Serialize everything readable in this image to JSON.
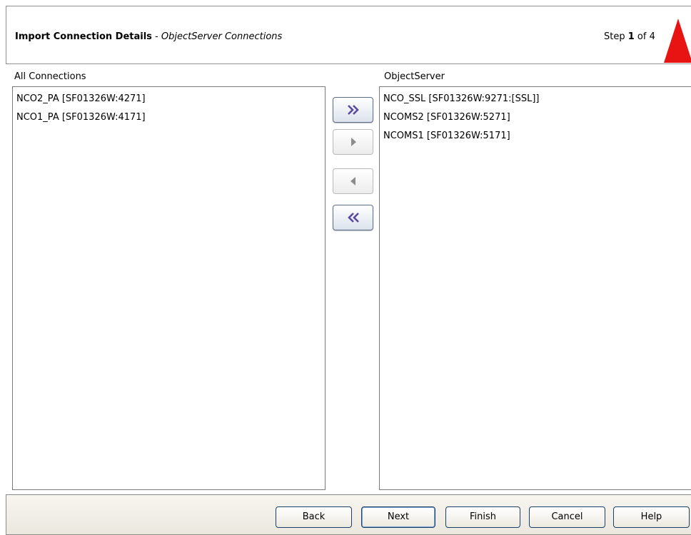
{
  "header": {
    "title": "Import Connection Details",
    "separator": " - ",
    "subtitle": "ObjectServer Connections",
    "step_prefix": "Step ",
    "step_current": "1",
    "step_suffix": " of 4"
  },
  "left_panel": {
    "label": "All Connections",
    "items": [
      "NCO2_PA [SF01326W:4271]",
      "NCO1_PA [SF01326W:4171]"
    ]
  },
  "right_panel": {
    "label": "ObjectServer",
    "items": [
      "NCO_SSL [SF01326W:9271:[SSL]]",
      "NCOMS2 [SF01326W:5271]",
      "NCOMS1 [SF01326W:5171]"
    ]
  },
  "transfer_buttons": [
    {
      "icon": "double-chevron-right-icon",
      "enabled": true
    },
    {
      "icon": "triangle-right-icon",
      "enabled": false
    },
    {
      "icon": "triangle-left-icon",
      "enabled": false
    },
    {
      "icon": "double-chevron-left-icon",
      "enabled": true
    }
  ],
  "footer": {
    "back_label": "Back",
    "next_label": "Next",
    "finish_label": "Finish",
    "cancel_label": "Cancel",
    "help_label": "Help"
  },
  "colors": {
    "warning_red": "#e81313",
    "button_border": "#1b3f6b",
    "chevron_purple": "#5b4a9e",
    "disabled_gray": "#8c8c8c"
  }
}
